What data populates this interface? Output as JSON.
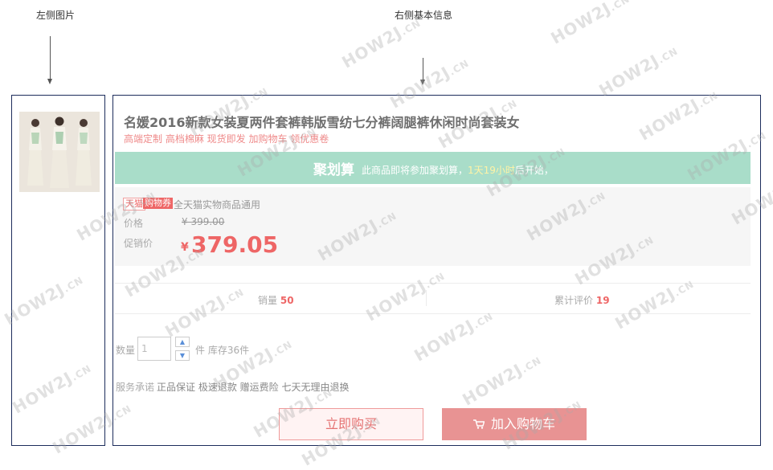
{
  "annotations": {
    "left": "左侧图片",
    "right": "右侧基本信息"
  },
  "product": {
    "title": "名媛2016新款女装夏两件套裤韩版雪纺七分裤阔腿裤休闲时尚套装女",
    "subtitle": "高端定制 高档棉麻 现货即发 加购物车 领优惠卷"
  },
  "juhuasuan": {
    "logo": "聚划算",
    "text_prefix": "此商品即将参加聚划算，",
    "countdown": "1天19小时",
    "text_suffix": "后开始，",
    "bg_color": "#a9ddc9"
  },
  "coupon": {
    "tag_tmall": "天猫",
    "tag_coupon": "购物券",
    "desc": "全天猫实物商品通用"
  },
  "price": {
    "label": "价格",
    "original": "¥ 399.00",
    "promo_label": "促销价",
    "currency": "¥",
    "promo": "379.05",
    "accent_color": "#ee6666"
  },
  "stats": {
    "sales_label": "销量",
    "sales": "50",
    "reviews_label": "累计评价",
    "reviews": "19"
  },
  "quantity": {
    "label": "数量",
    "value": "1",
    "up_icon": "arrow-up-icon",
    "down_icon": "arrow-down-icon",
    "stock_text": "件 库存36件"
  },
  "service": {
    "label": "服务承诺",
    "items": "正品保证 极速退款 赠运费险 七天无理由退换"
  },
  "buttons": {
    "buy": "立即购买",
    "cart": "加入购物车",
    "cart_icon": "shopping-cart-icon"
  },
  "watermark": {
    "text": "HOW2J",
    "suffix": ".CN"
  }
}
